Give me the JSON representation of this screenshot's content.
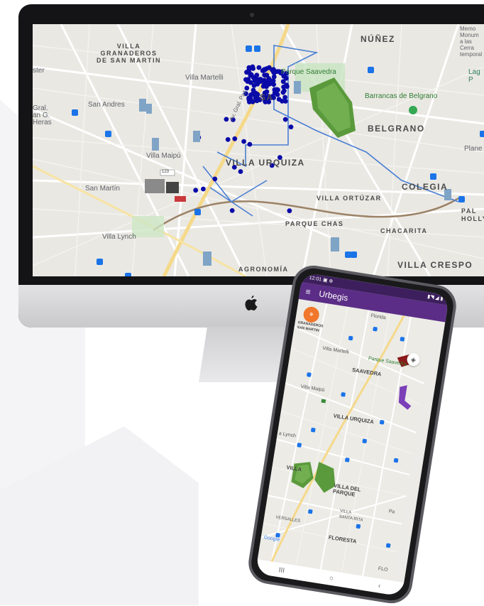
{
  "colors": {
    "point_blue": "#0a0aa8",
    "green_building": "#5a9a3c",
    "route_blue": "#4a7fd4",
    "app_purple": "#5b2d86",
    "fab_orange": "#f0772b"
  },
  "desktop_map": {
    "labels": {
      "villa_granaderos": "VILLA\nGRANADEROS\nDE SAN MARTIN",
      "nunez": "NÚÑEZ",
      "memo": "Memo\nMonum\na las\nCerra\ntemporal",
      "lag": "Lag\nP",
      "ster": "ster",
      "villa_martelli": "Villa Martelli",
      "parque_saavedra": "Parque Saavedra",
      "saavedra": "SA",
      "barrancas": "Barrancas de Belgrano",
      "san_andres": "San Andres",
      "gral_heras": "Gral.\nan G.\nHeras",
      "belgrano": "BELGRANO",
      "plane": "Plane",
      "villa_maipu": "Villa Maipú",
      "villa_urquiza": "VILLA URQUIZA",
      "ortuzar": "VILLA ORTÚZAR",
      "colegiales": "COLEGIA",
      "san_martin": "San Martín",
      "palermo": "PAL\nHOLLY",
      "parque_chas": "PARQUE CHAS",
      "chacarita": "CHACARITA",
      "villa_lynch": "Villa Lynch",
      "agronomia": "AGRONOMÍA",
      "villa_crespo": "VILLA CRESPO",
      "road_gral_paz": "Av. Gral. Paz",
      "bus_label": "123"
    },
    "point_count": 130
  },
  "phone": {
    "status_time": "12:01",
    "status_icons": "▣ ⊕",
    "status_right": "▮◥ ◢ ▮",
    "app_title": "Urbegis",
    "menu_icon": "≡",
    "fab_icon": "⌖",
    "layers_icon": "◈",
    "nav": {
      "recents": "III",
      "home": "○",
      "back": "‹"
    },
    "labels": {
      "granaderos": "GRANADEROS\nSAN MARTIN",
      "florida": "Florida",
      "villa_martelli": "Villa Martelli",
      "parque_saavedra": "Parque Saavedra",
      "saavedra": "SAAVEDRA",
      "villa_maipu": "Villa Maipú",
      "villa_urquiza": "VILLA URQUIZA",
      "lynch": "a Lynch",
      "villa": "VILLA",
      "villa_del_parque": "VILLA DEL\nPARQUE",
      "villa_santa_rita": "VILLA\nSANTA RITA",
      "floresta": "FLORESTA",
      "versalles": "VERSALLES",
      "pa": "Pa",
      "flo": "FLO",
      "google": "Google"
    }
  }
}
